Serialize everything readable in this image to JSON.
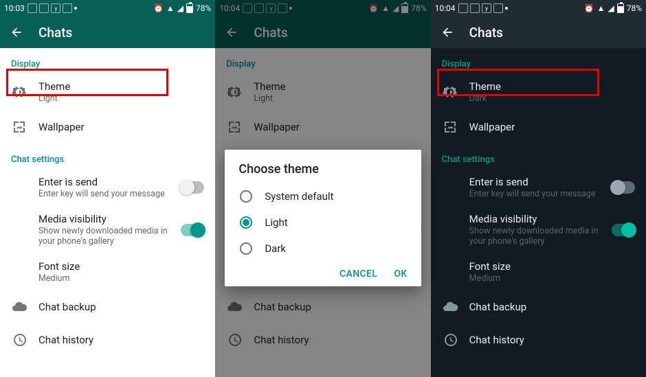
{
  "status": {
    "time_a": "10:03",
    "time_b": "10:04",
    "time_c": "10:04",
    "battery_pct": "78%",
    "icons_left": [
      "stack",
      "grid",
      "yfi",
      "arc"
    ],
    "icons_right": [
      "alarm",
      "wifi",
      "signal"
    ]
  },
  "appbar": {
    "title": "Chats"
  },
  "sections": {
    "display_header": "Display",
    "chat_settings_header": "Chat settings"
  },
  "rows": {
    "theme": {
      "title": "Theme",
      "value_light": "Light",
      "value_dark": "Dark"
    },
    "wallpaper": {
      "title": "Wallpaper"
    },
    "enter_is_send": {
      "title": "Enter is send",
      "subtitle": "Enter key will send your message",
      "state": "off"
    },
    "media_visibility": {
      "title": "Media visibility",
      "subtitle": "Show newly downloaded media in your phone's gallery",
      "state": "on"
    },
    "font_size": {
      "title": "Font size",
      "value": "Medium"
    },
    "chat_backup": {
      "title": "Chat backup"
    },
    "chat_history": {
      "title": "Chat history"
    }
  },
  "dialog": {
    "title": "Choose theme",
    "options": {
      "system": "System default",
      "light": "Light",
      "dark": "Dark"
    },
    "selected": "light",
    "cancel": "CANCEL",
    "ok": "OK"
  }
}
